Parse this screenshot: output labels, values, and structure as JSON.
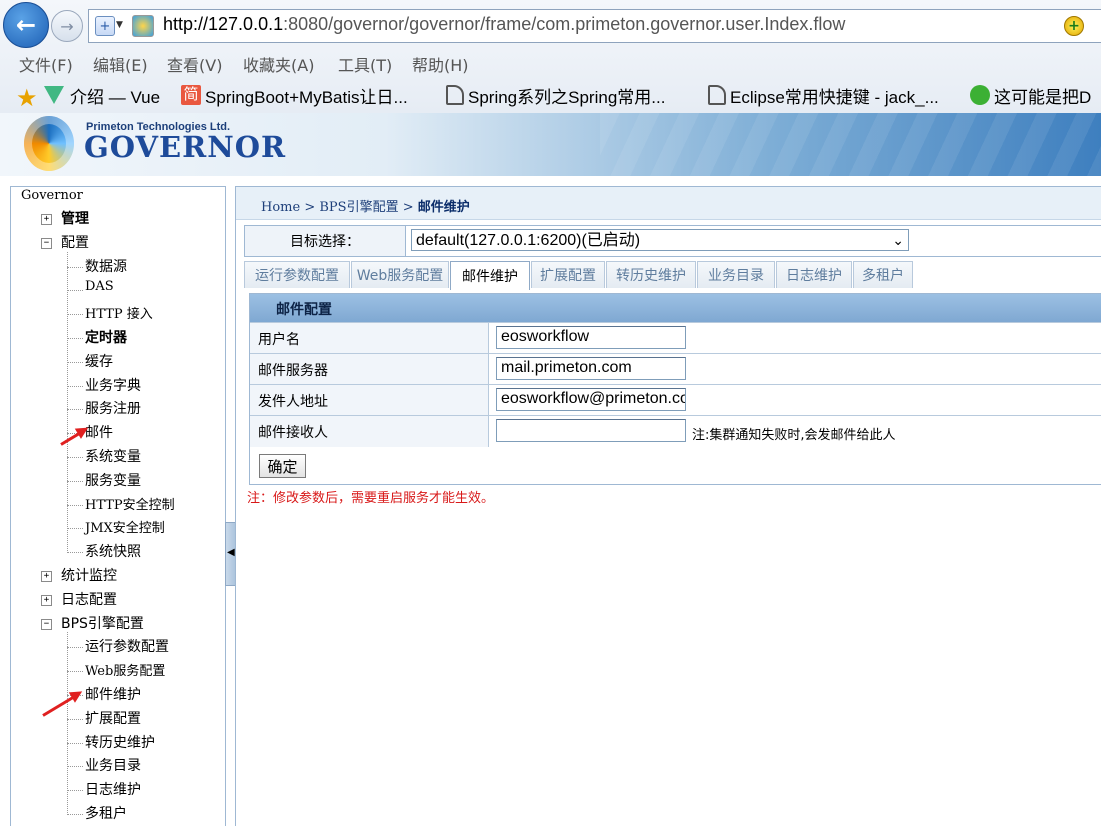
{
  "browser": {
    "url_host": "http://127.0.0.1",
    "url_path": ":8080/governor/governor/frame/com.primeton.governor.user.Index.flow",
    "menu": [
      "文件(F)",
      "编辑(E)",
      "查看(V)",
      "收藏夹(A)",
      "工具(T)",
      "帮助(H)"
    ],
    "favorites": [
      "介绍 — Vue",
      "SpringBoot+MyBatis让日...",
      "Spring系列之Spring常用...",
      "Eclipse常用快捷键 - jack_...",
      "这可能是把D"
    ],
    "fav_badge": "简"
  },
  "banner": {
    "company": "Primeton Technologies Ltd.",
    "product": "GOVERNOR"
  },
  "tree": {
    "root": "Governor",
    "groups": [
      {
        "label": "管理",
        "expanded": false,
        "bold": true,
        "children": []
      },
      {
        "label": "配置",
        "expanded": true,
        "bold": false,
        "children": [
          "数据源",
          "DAS",
          "HTTP 接入",
          "定时器",
          "缓存",
          "业务字典",
          "服务注册",
          "邮件",
          "系统变量",
          "服务变量",
          "HTTP安全控制",
          "JMX安全控制",
          "系统快照"
        ]
      },
      {
        "label": "统计监控",
        "expanded": false,
        "bold": false,
        "children": []
      },
      {
        "label": "日志配置",
        "expanded": false,
        "bold": false,
        "children": []
      },
      {
        "label": "BPS引擎配置",
        "expanded": true,
        "bold": false,
        "children": [
          "运行参数配置",
          "Web服务配置",
          "邮件维护",
          "扩展配置",
          "转历史维护",
          "业务目录",
          "日志维护",
          "多租户"
        ]
      }
    ],
    "expand_plus": "+",
    "expand_minus": "−"
  },
  "breadcrumb": {
    "home": "Home",
    "sep": ">",
    "section": "BPS引擎配置",
    "current": "邮件维护"
  },
  "target": {
    "label": "目标选择：",
    "value": "default(127.0.0.1:6200)(已启动)"
  },
  "tabs": [
    "运行参数配置",
    "Web服务配置",
    "邮件维护",
    "扩展配置",
    "转历史维护",
    "业务目录",
    "日志维护",
    "多租户"
  ],
  "active_tab": "邮件维护",
  "mail": {
    "title": "邮件配置",
    "fields": [
      {
        "label": "用户名",
        "value": "eosworkflow",
        "note": ""
      },
      {
        "label": "邮件服务器",
        "value": "mail.primeton.com",
        "note": ""
      },
      {
        "label": "发件人地址",
        "value": "eosworkflow@primeton.com",
        "note": ""
      },
      {
        "label": "邮件接收人",
        "value": "",
        "note": "注:集群通知失败时,会发邮件给此人"
      }
    ],
    "submit": "确定",
    "warning": "注：修改参数后，需要重启服务才能生效。"
  },
  "colors": {
    "accent": "#1e4b9a",
    "warning": "#d81818",
    "header": "#8fb5dc",
    "arrow": "#e02020"
  }
}
